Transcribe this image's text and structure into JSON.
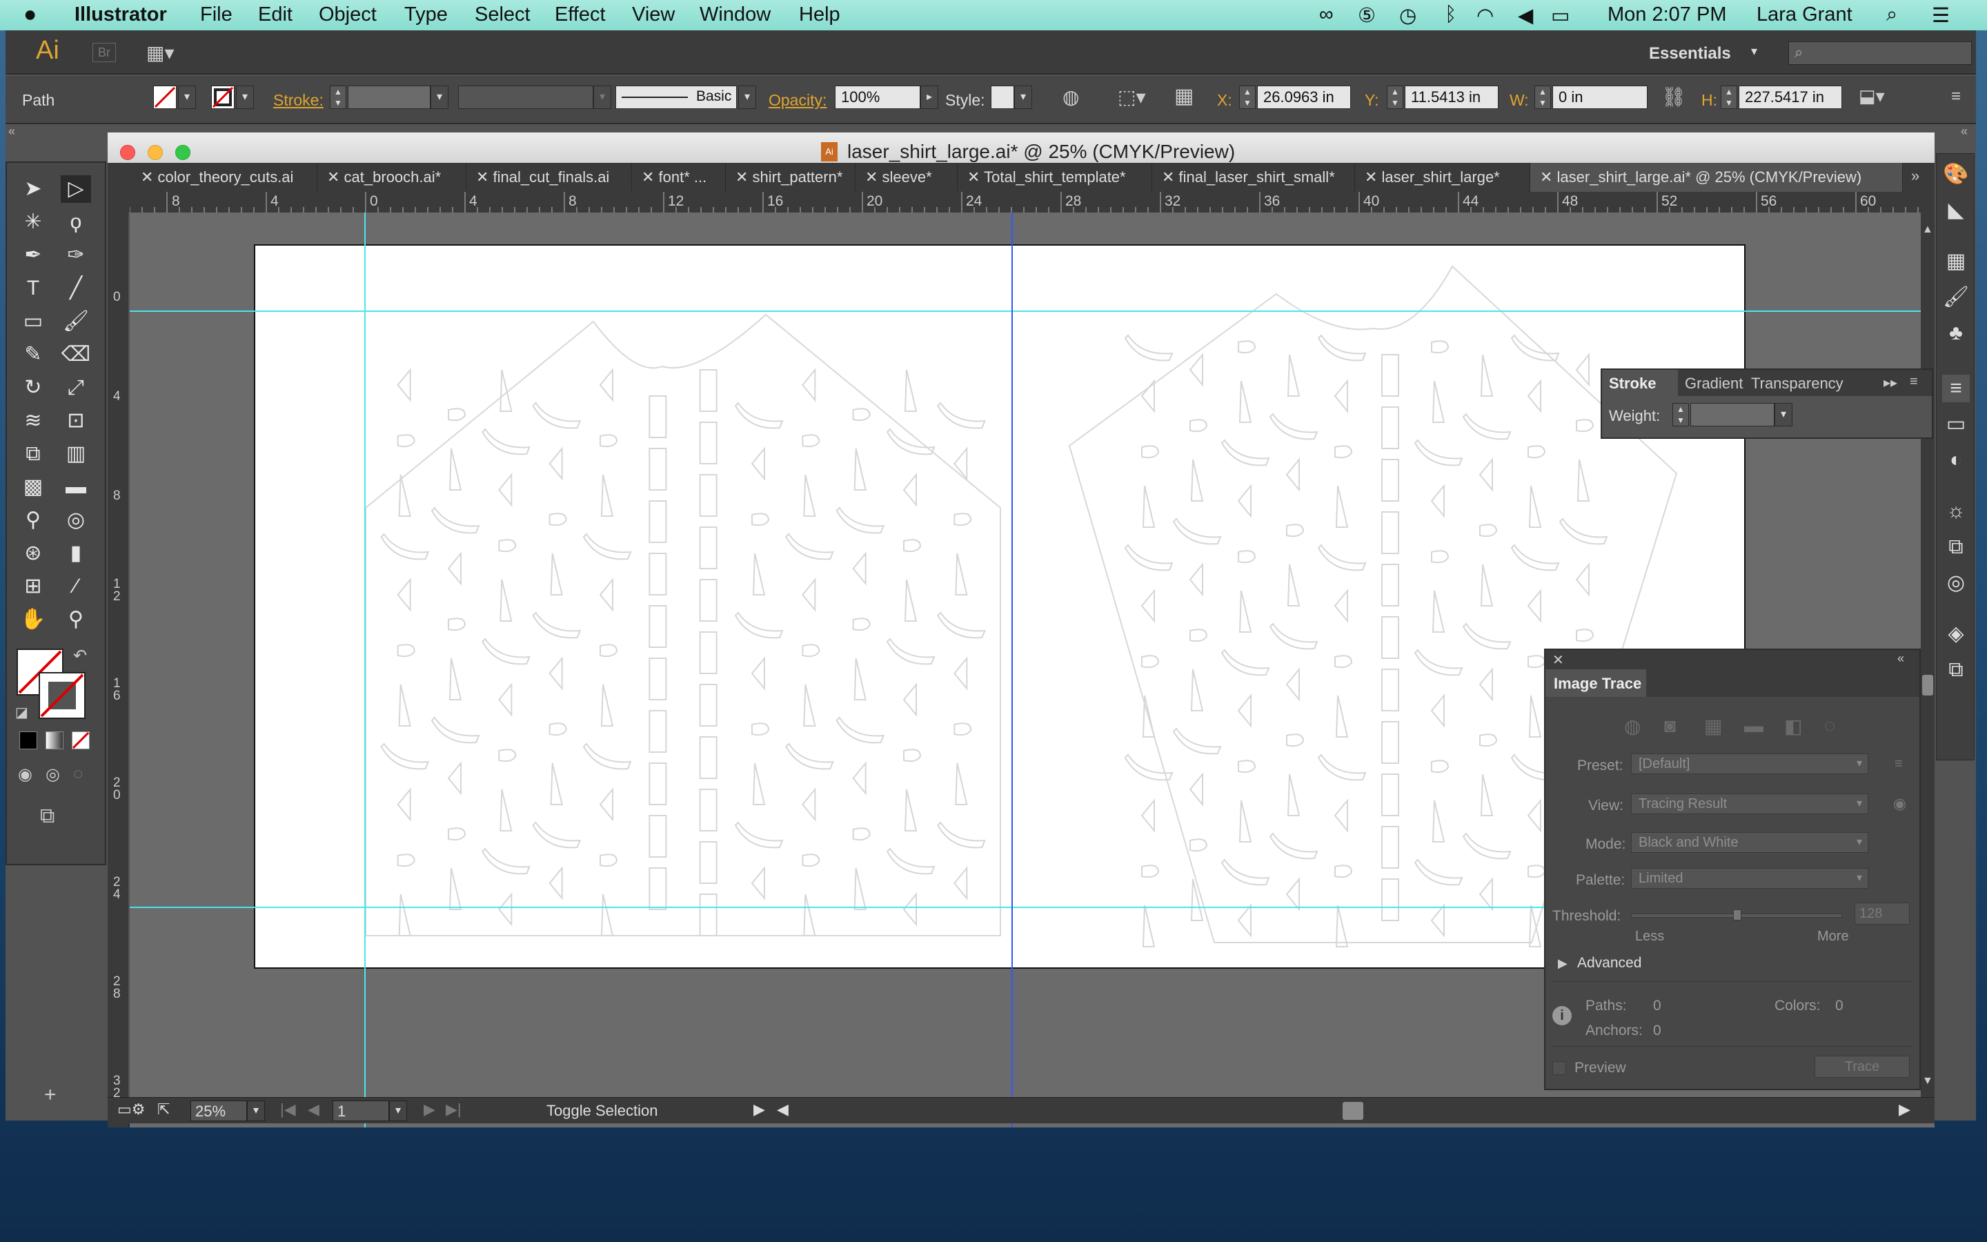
{
  "menubar": {
    "apple": "",
    "app_name": "Illustrator",
    "items": [
      "File",
      "Edit",
      "Object",
      "Type",
      "Select",
      "Effect",
      "View",
      "Window",
      "Help"
    ],
    "clock": "Mon 2:07 PM",
    "user": "Lara Grant"
  },
  "app": {
    "logo": "Ai",
    "bridge": "Br",
    "workspace": "Essentials",
    "search_placeholder": ""
  },
  "control_bar": {
    "selection_type": "Path",
    "stroke_label": "Stroke:",
    "brush_label": "Basic",
    "opacity_label": "Opacity:",
    "opacity_value": "100%",
    "style_label": "Style:",
    "x_label": "X:",
    "x_value": "26.0963 in",
    "y_label": "Y:",
    "y_value": "11.5413 in",
    "w_label": "W:",
    "w_value": "0 in",
    "h_label": "H:",
    "h_value": "227.5417 in"
  },
  "document": {
    "title": "laser_shirt_large.ai* @ 25% (CMYK/Preview)",
    "tabs": [
      {
        "label": "color_theory_cuts.ai",
        "active": false
      },
      {
        "label": "cat_brooch.ai*",
        "active": false
      },
      {
        "label": "final_cut_finals.ai",
        "active": false
      },
      {
        "label": "font* ...",
        "active": false
      },
      {
        "label": "shirt_pattern*",
        "active": false
      },
      {
        "label": "sleeve*",
        "active": false
      },
      {
        "label": "Total_shirt_template*",
        "active": false
      },
      {
        "label": "final_laser_shirt_small*",
        "active": false
      },
      {
        "label": "laser_shirt_large*",
        "active": false
      },
      {
        "label": "laser_shirt_large.ai* @ 25% (CMYK/Preview)",
        "active": true
      }
    ],
    "h_ruler_ticks": [
      "8",
      "4",
      "0",
      "4",
      "8",
      "12",
      "16",
      "20",
      "24",
      "28",
      "32",
      "36",
      "40",
      "44",
      "48",
      "52",
      "56",
      "60"
    ],
    "v_ruler_ticks": [
      "0",
      "4",
      "8",
      "1\n2",
      "1\n6",
      "2\n0",
      "2\n4",
      "2\n8",
      "3\n2"
    ]
  },
  "status_bar": {
    "zoom": "25%",
    "artboard_number": "1",
    "status_text": "Toggle Selection"
  },
  "stroke_panel": {
    "tabs": [
      "Stroke",
      "Gradient",
      "Transparency"
    ],
    "weight_label": "Weight:",
    "weight_value": ""
  },
  "image_trace": {
    "title": "Image Trace",
    "preset_label": "Preset:",
    "preset_value": "[Default]",
    "view_label": "View:",
    "view_value": "Tracing Result",
    "mode_label": "Mode:",
    "mode_value": "Black and White",
    "palette_label": "Palette:",
    "palette_value": "Limited",
    "threshold_label": "Threshold:",
    "threshold_value": "128",
    "threshold_fraction": 0.5,
    "less_label": "Less",
    "more_label": "More",
    "advanced_label": "Advanced",
    "paths_label": "Paths:",
    "paths_value": "0",
    "colors_label": "Colors:",
    "colors_value": "0",
    "anchors_label": "Anchors:",
    "anchors_value": "0",
    "preview_label": "Preview",
    "trace_button": "Trace"
  },
  "colors": {
    "menubar_bg": "#98e2d6",
    "ui_dark": "#3b3b3b",
    "ui_mid": "#535353",
    "accent_orange": "#e0a52f",
    "guide_cyan": "#49e5ea",
    "selection_blue": "#3355ff"
  }
}
